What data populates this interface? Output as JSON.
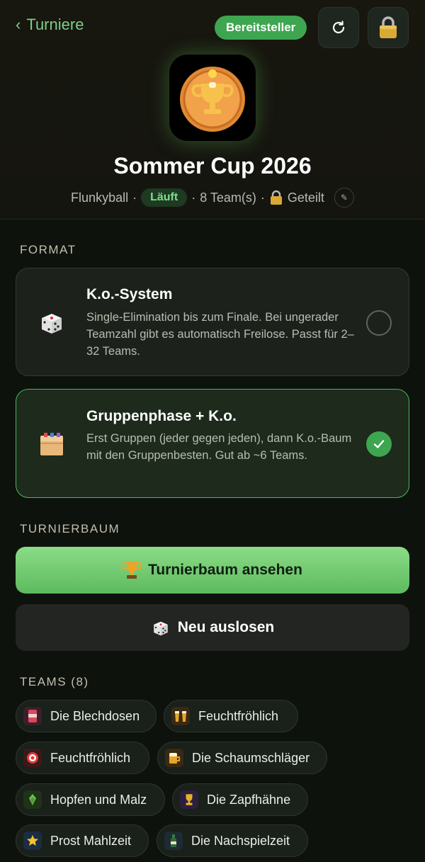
{
  "nav": {
    "back_label": "Turniere",
    "provider_badge": "Bereitsteller"
  },
  "tournament": {
    "name": "Sommer Cup 2026",
    "sport": "Flunkyball",
    "status": "Läuft",
    "teams_count": "8 Team(s)",
    "visibility": "Geteilt",
    "separator": "·"
  },
  "format": {
    "section_label": "FORMAT",
    "options": [
      {
        "name": "K.o.-System",
        "description": "Single-Elimination bis zum Finale. Bei ungerader Teamzahl gibt es automatisch Freilose. Passt für 2–32 Teams.",
        "icon": "dice-icon",
        "selected": false
      },
      {
        "name": "Gruppenphase + K.o.",
        "description": "Erst Gruppen (jeder gegen jeden), dann K.o.-Baum mit den Gruppenbesten. Gut ab ~6 Teams.",
        "icon": "box-icon",
        "selected": true
      }
    ]
  },
  "bracket": {
    "section_label": "TURNIERBAUM",
    "view_button": "Turnierbaum ansehen",
    "redraw_button": "Neu auslosen"
  },
  "teams": {
    "section_label": "TEAMS (8)",
    "items": [
      {
        "name": "Die Blechdosen",
        "icon": "can-icon"
      },
      {
        "name": "Feuchtfröhlich",
        "icon": "beers-icon"
      },
      {
        "name": "Feuchtfröhlich",
        "icon": "target-icon"
      },
      {
        "name": "Die Schaumschläger",
        "icon": "beer-mug-icon"
      },
      {
        "name": "Hopfen und Malz",
        "icon": "hops-icon"
      },
      {
        "name": "Die Zapfhähne",
        "icon": "trophy-icon"
      },
      {
        "name": "Prost Mahlzeit",
        "icon": "star-icon"
      },
      {
        "name": "Die Nachspielzeit",
        "icon": "bottle-icon"
      }
    ]
  },
  "colors": {
    "accent": "#3ea550",
    "background": "#0e120d",
    "card": "#1c221b"
  }
}
